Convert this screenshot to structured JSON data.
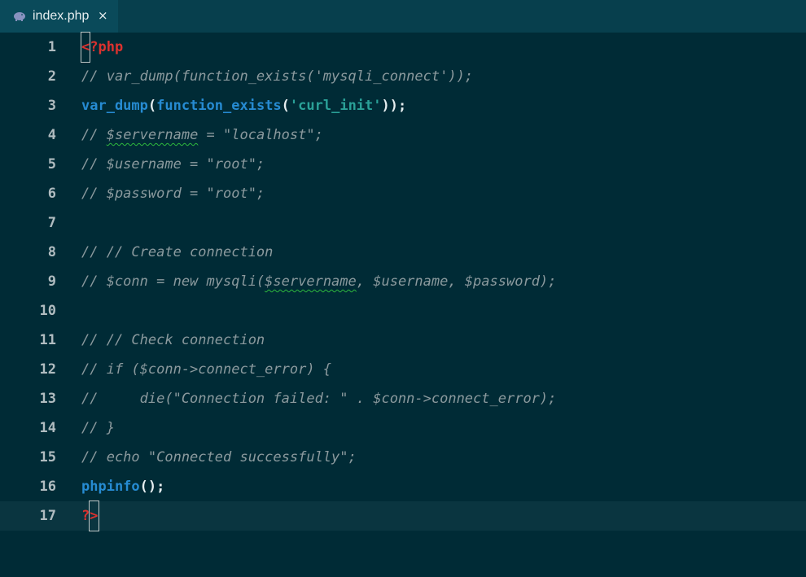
{
  "tab": {
    "icon": "php-elephant-icon",
    "label": "index.php",
    "close": "×"
  },
  "colors": {
    "background": "#002b36",
    "comment": "#8b9a9e",
    "function": "#268bd2",
    "string": "#2aa198",
    "php_tag": "#dc322f"
  },
  "lines": [
    {
      "num": "1",
      "t": {
        "a": "<",
        "b": "?php"
      }
    },
    {
      "num": "2",
      "text": "// var_dump(function_exists('mysqli_connect'));"
    },
    {
      "num": "3",
      "t": {
        "f1": "var_dump",
        "p1": "(",
        "f2": "function_exists",
        "p2": "(",
        "s": "'curl_init'",
        "p3": "));"
      }
    },
    {
      "num": "4",
      "t": {
        "a": "// ",
        "b": "$servername",
        "c": " = \"localhost\";"
      }
    },
    {
      "num": "5",
      "text": "// $username = \"root\";"
    },
    {
      "num": "6",
      "text": "// $password = \"root\";"
    },
    {
      "num": "7",
      "text": ""
    },
    {
      "num": "8",
      "text": "// // Create connection"
    },
    {
      "num": "9",
      "t": {
        "a": "// $conn = new mysqli(",
        "b": "$servername",
        "c": ", $username, $password);"
      }
    },
    {
      "num": "10",
      "text": ""
    },
    {
      "num": "11",
      "text": "// // Check connection"
    },
    {
      "num": "12",
      "text": "// if ($conn->connect_error) {"
    },
    {
      "num": "13",
      "text": "//     die(\"Connection failed: \" . $conn->connect_error);"
    },
    {
      "num": "14",
      "text": "// }"
    },
    {
      "num": "15",
      "text": "// echo \"Connected successfully\";"
    },
    {
      "num": "16",
      "t": {
        "f": "phpinfo",
        "p": "();"
      }
    },
    {
      "num": "17",
      "t": {
        "a": "?",
        "b": ">"
      }
    }
  ]
}
